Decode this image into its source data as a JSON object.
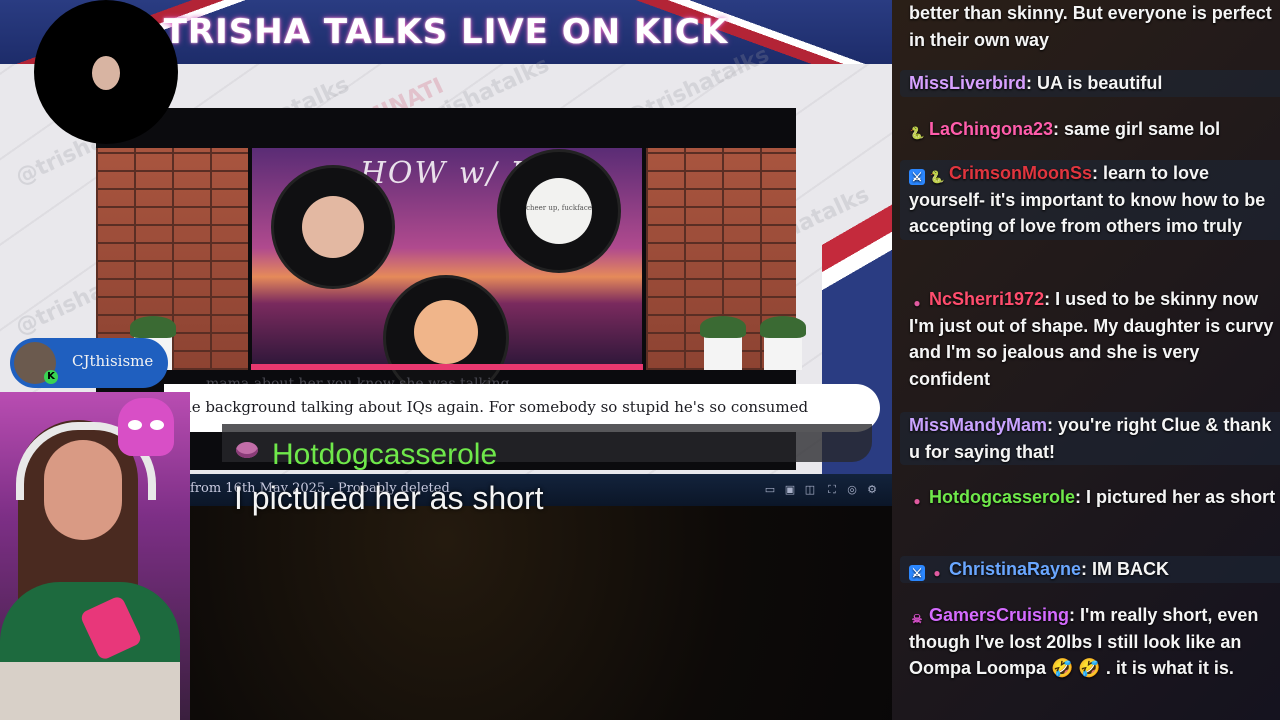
{
  "banner": {
    "title": "TRISHA TALKS LIVE ON KICK"
  },
  "watermarks": [
    "@trishatalks",
    "CLUEMINATI",
    "CLUE MINATI"
  ],
  "video": {
    "poster_title": "HOW w/ B",
    "disc2_text": "cheer up, fuckface",
    "faded_subtitle": "mama about her you know she was talking",
    "caption": "the background talking about IQs again. For somebody so stupid he's so consumed",
    "player_caption": "from 16th May 2025 - Probably deleted"
  },
  "overlay": {
    "username": "Hotdogcasserole",
    "message": "I pictured her as short",
    "emote_icon": "brain-emote-icon"
  },
  "user_pill": {
    "name": "CJthisisme"
  },
  "chat": {
    "messages": [
      {
        "text": "better than skinny. But everyone is perfect in their own way",
        "continuation": true
      },
      {
        "user": "MissLiverbird",
        "color": "#d7a1ff",
        "badges": [],
        "text": "UA is beautiful"
      },
      {
        "user": "LaChingona23",
        "color": "#ff5dab",
        "badges": [
          "snake"
        ],
        "text": "same girl same lol"
      },
      {
        "user": "CrimsonMoonSs",
        "color": "#e0353e",
        "badges": [
          "mod",
          "snake"
        ],
        "text": "learn to love yourself- it's important to know how to be accepting of love from others imo truly"
      },
      {
        "user": "NcSherri1972",
        "color": "#ff4d6d",
        "badges": [
          "brain"
        ],
        "text": "I used to be skinny now I'm just out of shape. My daughter is curvy and I'm so jealous and she is very confident"
      },
      {
        "user": "MissMandyMam",
        "color": "#c9a3ff",
        "badges": [],
        "text": "you're right Clue & thank u for saying that!"
      },
      {
        "user": "Hotdogcasserole",
        "color": "#6fe84a",
        "badges": [
          "brain"
        ],
        "text": "I pictured her as short"
      },
      {
        "user": "ChristinaRayne",
        "color": "#6aa7ff",
        "badges": [
          "mod",
          "brain"
        ],
        "text": "IM BACK"
      },
      {
        "user": "GamersCruising",
        "color": "#d56bff",
        "badges": [
          "skull"
        ],
        "text": "I'm really short, even though I've lost 20lbs I still look like an Oompa Loompa 🤣 🤣 . it is what it is."
      }
    ]
  },
  "colors": {
    "kick_green": "#39d353",
    "banner_blue": "#2a3c82",
    "accent_pink": "#d84fc6"
  }
}
